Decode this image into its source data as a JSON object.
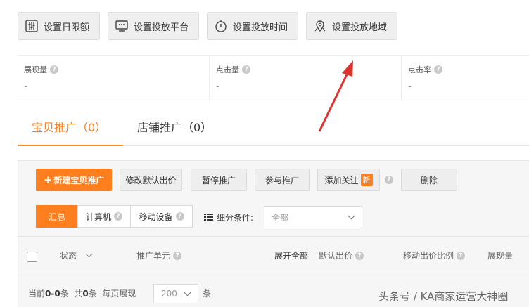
{
  "top_buttons": [
    {
      "label": "设置日限额",
      "icon": "sliders-icon"
    },
    {
      "label": "设置投放平台",
      "icon": "monitor-icon"
    },
    {
      "label": "设置投放时间",
      "icon": "stopwatch-icon"
    },
    {
      "label": "设置投放地域",
      "icon": "map-pin-icon"
    }
  ],
  "stats": [
    {
      "label": "展现量",
      "value": "-"
    },
    {
      "label": "点击量",
      "value": "-"
    },
    {
      "label": "点击率",
      "value": "-"
    }
  ],
  "tabs": [
    {
      "label": "宝贝推广（0）",
      "active": true
    },
    {
      "label": "店铺推广（0）",
      "active": false
    }
  ],
  "actions": {
    "new": "新建宝贝推广",
    "modify_price": "修改默认出价",
    "pause": "暂停推广",
    "join": "参与推广",
    "follow": "添加关注",
    "new_badge": "新",
    "delete": "删除"
  },
  "filters": {
    "summary": "汇总",
    "computer": "计算机",
    "mobile": "移动设备",
    "condition_label": "细分条件:",
    "condition_value": "全部"
  },
  "table_headers": {
    "status": "状态",
    "unit": "推广单元",
    "expand_all": "展开全部",
    "default_bid": "默认出价",
    "mobile_ratio": "移动出价比例",
    "impressions": "展现量"
  },
  "pagination": {
    "current_prefix": "当前",
    "current_range": "0-0",
    "items_suffix": "条",
    "total_prefix": "共",
    "total": "0",
    "per_page_label": "每页展现",
    "per_page": "200",
    "per_page_suffix": "条"
  },
  "watermark": "头条号 / KA商家运营大神圈",
  "colors": {
    "accent": "#ff7e1d",
    "arrow": "#e0322d"
  }
}
